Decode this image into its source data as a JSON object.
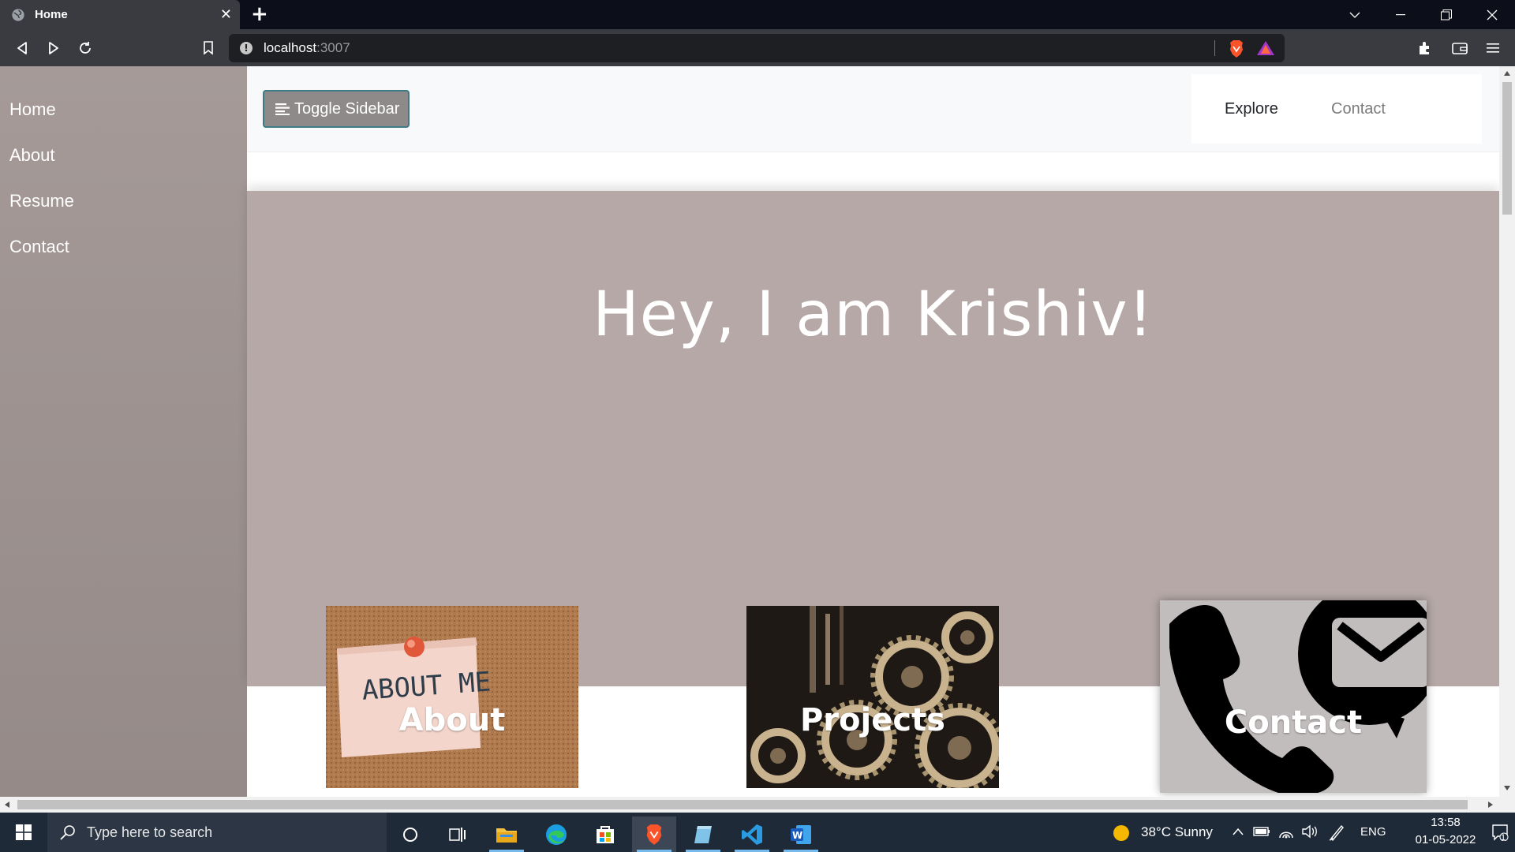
{
  "browser": {
    "tab_title": "Home",
    "new_tab": "+",
    "url_host": "localhost",
    "url_port": ":3007"
  },
  "sidebar": {
    "items": [
      {
        "label": "Home"
      },
      {
        "label": "About"
      },
      {
        "label": "Resume"
      },
      {
        "label": "Contact"
      }
    ]
  },
  "navbar": {
    "toggle_label": "Toggle Sidebar",
    "links": [
      {
        "label": "Explore",
        "color": "#212529"
      },
      {
        "label": "Contact",
        "color": "#7a7a7a"
      }
    ]
  },
  "hero": {
    "heading": "Hey, I am Krishiv!"
  },
  "cards": [
    {
      "label": "About",
      "image_text": "ABOUT ME"
    },
    {
      "label": "Projects"
    },
    {
      "label": "Contact"
    }
  ],
  "taskbar": {
    "search_placeholder": "Type here to search",
    "weather": "38°C  Sunny",
    "language": "ENG",
    "time": "13:58",
    "date": "01-05-2022",
    "notification_count": "1"
  },
  "colors": {
    "sidebar": "#a59a98",
    "hero": "#b5a8a6",
    "toggle_button": "#8f8a8a",
    "toggle_border": "#3f7b84"
  }
}
